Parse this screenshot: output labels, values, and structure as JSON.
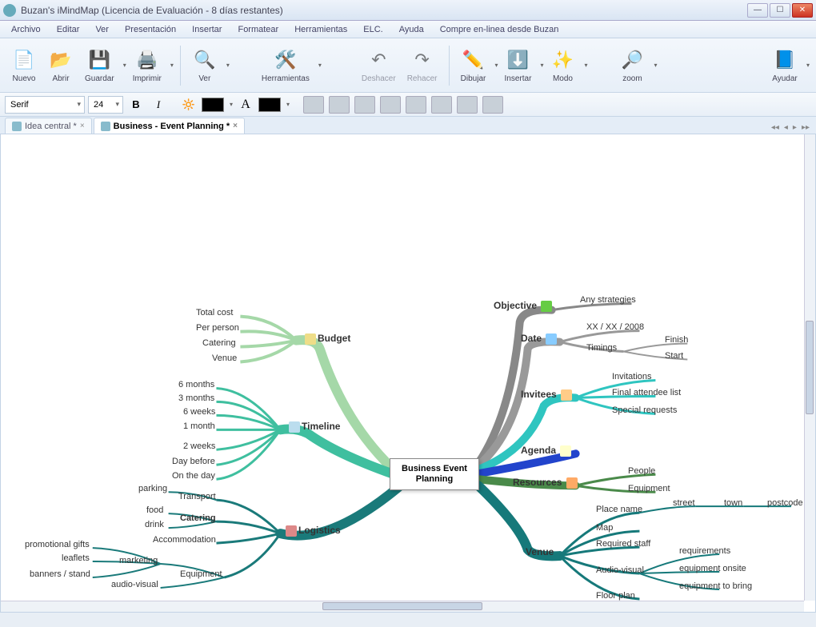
{
  "title": "Buzan's iMindMap (Licencia de Evaluación -   8 días restantes)",
  "menu": [
    "Archivo",
    "Editar",
    "Ver",
    "Presentación",
    "Insertar",
    "Formatear",
    "Herramientas",
    "ELC.",
    "Ayuda",
    "Compre en-linea desde Buzan"
  ],
  "ribbon": {
    "nuevo": "Nuevo",
    "abrir": "Abrir",
    "guardar": "Guardar",
    "imprimir": "Imprimir",
    "ver": "Ver",
    "herramientas": "Herramientas",
    "deshacer": "Deshacer",
    "rehacer": "Rehacer",
    "dibujar": "Dibujar",
    "insertar": "Insertar",
    "modo": "Modo",
    "zoom": "zoom",
    "ayudar": "Ayudar"
  },
  "format": {
    "font": "Serif",
    "size": "24",
    "bold": "B",
    "italic": "I"
  },
  "tabs": [
    {
      "label": "Idea central *",
      "active": false
    },
    {
      "label": "Business - Event Planning *",
      "active": true
    }
  ],
  "mindmap": {
    "central": "Business Event Planning",
    "budget": {
      "label": "Budget",
      "items": [
        "Total cost",
        "Per person",
        "Catering",
        "Venue"
      ]
    },
    "timeline": {
      "label": "Timeline",
      "items": [
        "6 months",
        "3 months",
        "6 weeks",
        "1 month",
        "2 weeks",
        "Day before",
        "On the day"
      ]
    },
    "logistics": {
      "label": "Logistics",
      "transport": {
        "label": "Transport",
        "items": [
          "parking"
        ]
      },
      "catering": {
        "label": "Catering",
        "items": [
          "food",
          "drink"
        ]
      },
      "accommodation": "Accommodation",
      "equipment": {
        "label": "Equipment",
        "items": [
          "marketing",
          "audio-visual"
        ]
      },
      "marketing_items": [
        "promotional gifts",
        "leaflets",
        "banners / stand"
      ]
    },
    "objective": {
      "label": "Objective",
      "items": [
        "Any strategies"
      ]
    },
    "date": {
      "label": "Date",
      "value": "XX / XX / 2008",
      "timings": {
        "label": "Timings",
        "items": [
          "Finish",
          "Start"
        ]
      }
    },
    "invitees": {
      "label": "Invitees",
      "items": [
        "Invitations",
        "Final attendee list",
        "Special requests"
      ]
    },
    "agenda": {
      "label": "Agenda"
    },
    "resources": {
      "label": "Resources",
      "items": [
        "People",
        "Equipment"
      ]
    },
    "venue": {
      "label": "Venue",
      "place": {
        "label": "Place name",
        "items": [
          "street",
          "town",
          "postcode"
        ]
      },
      "map": "Map",
      "staff": "Required staff",
      "av": {
        "label": "Audio-visual",
        "items": [
          "requirements",
          "equipment onsite",
          "equipment to bring"
        ]
      },
      "floor": "Floor plan"
    }
  }
}
